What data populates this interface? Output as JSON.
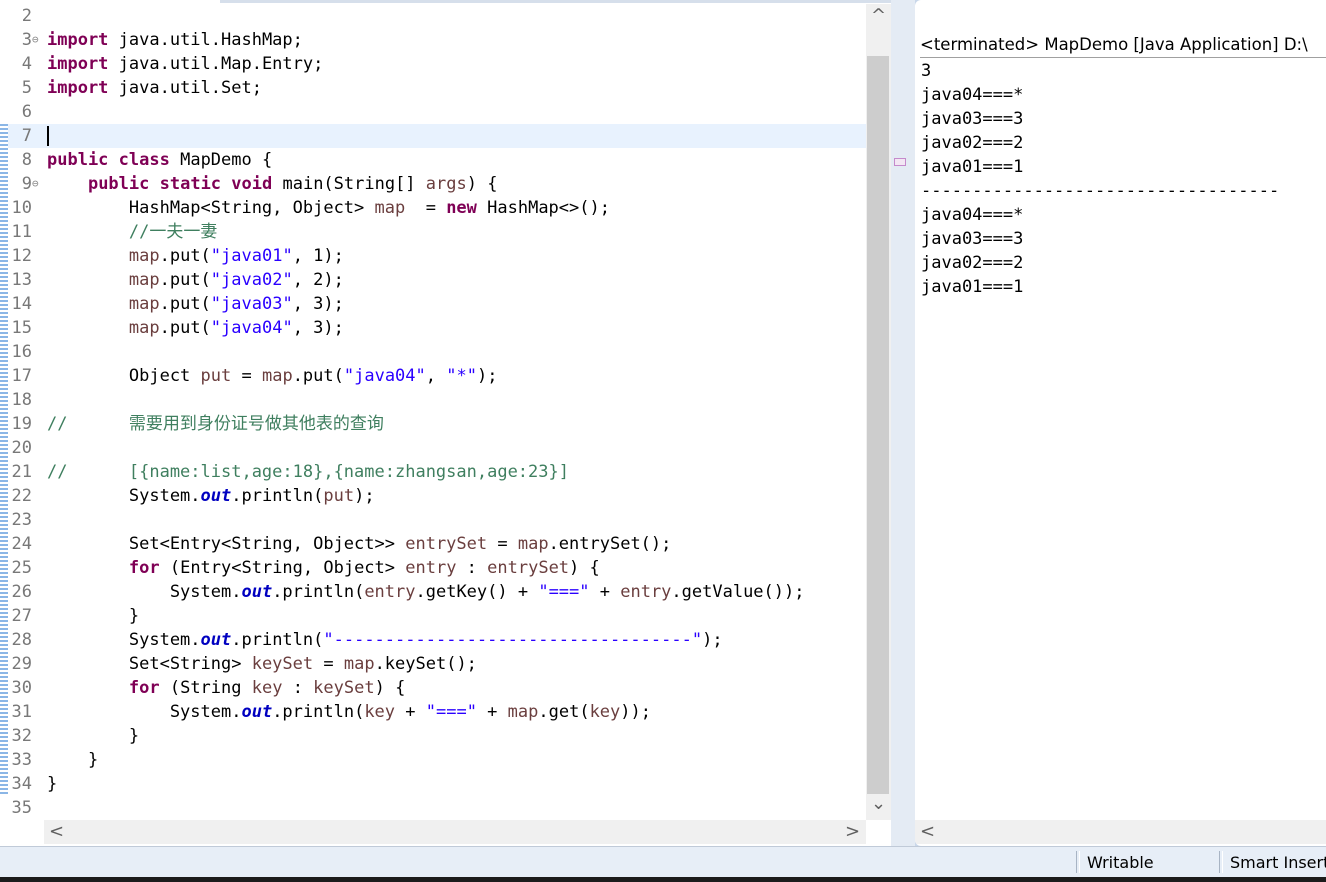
{
  "editor": {
    "lines": [
      {
        "num": "2",
        "fold": "",
        "segs": []
      },
      {
        "num": "3",
        "fold": "⊖",
        "segs": [
          {
            "t": "import",
            "c": "kw"
          },
          {
            "t": " java.util.HashMap;"
          }
        ]
      },
      {
        "num": "4",
        "fold": "",
        "segs": [
          {
            "t": "import",
            "c": "kw"
          },
          {
            "t": " java.util.Map.Entry;"
          }
        ]
      },
      {
        "num": "5",
        "fold": "",
        "segs": [
          {
            "t": "import",
            "c": "kw"
          },
          {
            "t": " java.util.Set;"
          }
        ]
      },
      {
        "num": "6",
        "fold": "",
        "segs": []
      },
      {
        "num": "7",
        "fold": "",
        "segs": []
      },
      {
        "num": "8",
        "fold": "",
        "segs": [
          {
            "t": "public",
            "c": "kw"
          },
          {
            "t": " "
          },
          {
            "t": "class",
            "c": "kw"
          },
          {
            "t": " MapDemo {"
          }
        ]
      },
      {
        "num": "9",
        "fold": "⊖",
        "segs": [
          {
            "t": "    "
          },
          {
            "t": "public",
            "c": "kw"
          },
          {
            "t": " "
          },
          {
            "t": "static",
            "c": "kw"
          },
          {
            "t": " "
          },
          {
            "t": "void",
            "c": "kw"
          },
          {
            "t": " main(String[] "
          },
          {
            "t": "args",
            "c": "var"
          },
          {
            "t": ") {"
          }
        ]
      },
      {
        "num": "10",
        "fold": "",
        "segs": [
          {
            "t": "        HashMap<String, Object> "
          },
          {
            "t": "map",
            "c": "var"
          },
          {
            "t": "  = "
          },
          {
            "t": "new",
            "c": "kw"
          },
          {
            "t": " HashMap<>();"
          }
        ]
      },
      {
        "num": "11",
        "fold": "",
        "segs": [
          {
            "t": "        //一夫一妻",
            "c": "cmt"
          }
        ]
      },
      {
        "num": "12",
        "fold": "",
        "segs": [
          {
            "t": "        "
          },
          {
            "t": "map",
            "c": "var"
          },
          {
            "t": ".put("
          },
          {
            "t": "\"java01\"",
            "c": "str"
          },
          {
            "t": ", 1);"
          }
        ]
      },
      {
        "num": "13",
        "fold": "",
        "segs": [
          {
            "t": "        "
          },
          {
            "t": "map",
            "c": "var"
          },
          {
            "t": ".put("
          },
          {
            "t": "\"java02\"",
            "c": "str"
          },
          {
            "t": ", 2);"
          }
        ]
      },
      {
        "num": "14",
        "fold": "",
        "segs": [
          {
            "t": "        "
          },
          {
            "t": "map",
            "c": "var"
          },
          {
            "t": ".put("
          },
          {
            "t": "\"java03\"",
            "c": "str"
          },
          {
            "t": ", 3);"
          }
        ]
      },
      {
        "num": "15",
        "fold": "",
        "segs": [
          {
            "t": "        "
          },
          {
            "t": "map",
            "c": "var"
          },
          {
            "t": ".put("
          },
          {
            "t": "\"java04\"",
            "c": "str"
          },
          {
            "t": ", 3);"
          }
        ]
      },
      {
        "num": "16",
        "fold": "",
        "segs": []
      },
      {
        "num": "17",
        "fold": "",
        "segs": [
          {
            "t": "        Object "
          },
          {
            "t": "put",
            "c": "var"
          },
          {
            "t": " = "
          },
          {
            "t": "map",
            "c": "var"
          },
          {
            "t": ".put("
          },
          {
            "t": "\"java04\"",
            "c": "str"
          },
          {
            "t": ", "
          },
          {
            "t": "\"*\"",
            "c": "str"
          },
          {
            "t": ");"
          }
        ]
      },
      {
        "num": "18",
        "fold": "",
        "segs": []
      },
      {
        "num": "19",
        "fold": "",
        "segs": [
          {
            "t": "//      需要用到身份证号做其他表的查询",
            "c": "cmt"
          }
        ]
      },
      {
        "num": "20",
        "fold": "",
        "segs": []
      },
      {
        "num": "21",
        "fold": "",
        "segs": [
          {
            "t": "//      [{name:list,age:18},{name:zhangsan,age:23}]",
            "c": "cmt"
          }
        ]
      },
      {
        "num": "22",
        "fold": "",
        "segs": [
          {
            "t": "        System."
          },
          {
            "t": "out",
            "c": "fld"
          },
          {
            "t": ".println("
          },
          {
            "t": "put",
            "c": "var"
          },
          {
            "t": ");"
          }
        ]
      },
      {
        "num": "23",
        "fold": "",
        "segs": []
      },
      {
        "num": "24",
        "fold": "",
        "segs": [
          {
            "t": "        Set<Entry<String, Object>> "
          },
          {
            "t": "entrySet",
            "c": "var"
          },
          {
            "t": " = "
          },
          {
            "t": "map",
            "c": "var"
          },
          {
            "t": ".entrySet();"
          }
        ]
      },
      {
        "num": "25",
        "fold": "",
        "segs": [
          {
            "t": "        "
          },
          {
            "t": "for",
            "c": "kw"
          },
          {
            "t": " (Entry<String, Object> "
          },
          {
            "t": "entry",
            "c": "var"
          },
          {
            "t": " : "
          },
          {
            "t": "entrySet",
            "c": "var"
          },
          {
            "t": ") {"
          }
        ]
      },
      {
        "num": "26",
        "fold": "",
        "segs": [
          {
            "t": "            System."
          },
          {
            "t": "out",
            "c": "fld"
          },
          {
            "t": ".println("
          },
          {
            "t": "entry",
            "c": "var"
          },
          {
            "t": ".getKey() + "
          },
          {
            "t": "\"===\"",
            "c": "str"
          },
          {
            "t": " + "
          },
          {
            "t": "entry",
            "c": "var"
          },
          {
            "t": ".getValue());"
          }
        ]
      },
      {
        "num": "27",
        "fold": "",
        "segs": [
          {
            "t": "        }"
          }
        ]
      },
      {
        "num": "28",
        "fold": "",
        "segs": [
          {
            "t": "        System."
          },
          {
            "t": "out",
            "c": "fld"
          },
          {
            "t": ".println("
          },
          {
            "t": "\"-----------------------------------\"",
            "c": "str"
          },
          {
            "t": ");"
          }
        ]
      },
      {
        "num": "29",
        "fold": "",
        "segs": [
          {
            "t": "        Set<String> "
          },
          {
            "t": "keySet",
            "c": "var"
          },
          {
            "t": " = "
          },
          {
            "t": "map",
            "c": "var"
          },
          {
            "t": ".keySet();"
          }
        ]
      },
      {
        "num": "30",
        "fold": "",
        "segs": [
          {
            "t": "        "
          },
          {
            "t": "for",
            "c": "kw"
          },
          {
            "t": " (String "
          },
          {
            "t": "key",
            "c": "var"
          },
          {
            "t": " : "
          },
          {
            "t": "keySet",
            "c": "var"
          },
          {
            "t": ") {"
          }
        ]
      },
      {
        "num": "31",
        "fold": "",
        "segs": [
          {
            "t": "            System."
          },
          {
            "t": "out",
            "c": "fld"
          },
          {
            "t": ".println("
          },
          {
            "t": "key",
            "c": "var"
          },
          {
            "t": " + "
          },
          {
            "t": "\"===\"",
            "c": "str"
          },
          {
            "t": " + "
          },
          {
            "t": "map",
            "c": "var"
          },
          {
            "t": ".get("
          },
          {
            "t": "key",
            "c": "var"
          },
          {
            "t": "));"
          }
        ]
      },
      {
        "num": "32",
        "fold": "",
        "segs": [
          {
            "t": "        }"
          }
        ]
      },
      {
        "num": "33",
        "fold": "",
        "segs": [
          {
            "t": "    }"
          }
        ]
      },
      {
        "num": "34",
        "fold": "",
        "segs": [
          {
            "t": "}"
          }
        ]
      },
      {
        "num": "35",
        "fold": "",
        "segs": []
      }
    ],
    "scroll_up": "^",
    "scroll_down": "⌄",
    "scroll_left": "<",
    "scroll_right": ">"
  },
  "console": {
    "header": "<terminated> MapDemo [Java Application] D:\\",
    "lines": [
      "3",
      "java04===*",
      "java03===3",
      "java02===2",
      "java01===1",
      "-----------------------------------",
      "java04===*",
      "java03===3",
      "java02===2",
      "java01===1"
    ],
    "scroll_left": "<"
  },
  "statusbar": {
    "writable": "Writable",
    "insert_mode": "Smart Insert"
  }
}
